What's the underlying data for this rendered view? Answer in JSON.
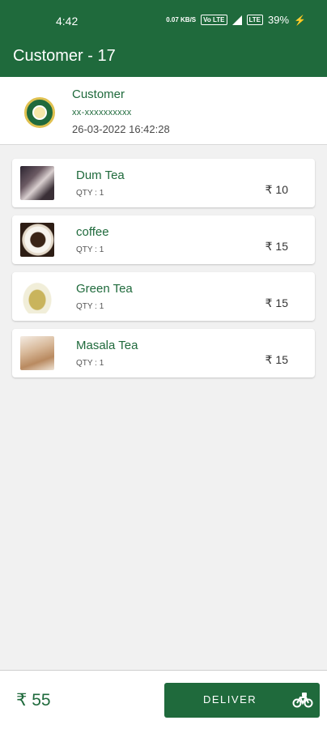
{
  "status_bar": {
    "time": "4:42",
    "net_speed": "0.07 KB/S",
    "volte": "Vo LTE",
    "lte": "LTE",
    "battery": "39%"
  },
  "app_bar": {
    "title": "Customer - 17"
  },
  "customer": {
    "name": "Customer",
    "phone": "xx-xxxxxxxxxx",
    "datetime": "26-03-2022 16:42:28",
    "logo_icon": "tea-world-logo"
  },
  "items": [
    {
      "name": "Dum Tea",
      "qty": "QTY : 1",
      "price": "₹ 10",
      "image": "dum-tea-image"
    },
    {
      "name": "coffee",
      "qty": "QTY : 1",
      "price": "₹ 15",
      "image": "coffee-image"
    },
    {
      "name": "Green Tea",
      "qty": "QTY : 1",
      "price": "₹ 15",
      "image": "green-tea-image"
    },
    {
      "name": "Masala Tea",
      "qty": "QTY : 1",
      "price": "₹ 15",
      "image": "masala-tea-image"
    }
  ],
  "footer": {
    "total": "₹ 55",
    "deliver_label": "DELIVER",
    "deliver_icon": "delivery-bike-icon"
  },
  "colors": {
    "primary": "#1f6a3c",
    "background": "#f1f1f1",
    "card": "#ffffff"
  }
}
